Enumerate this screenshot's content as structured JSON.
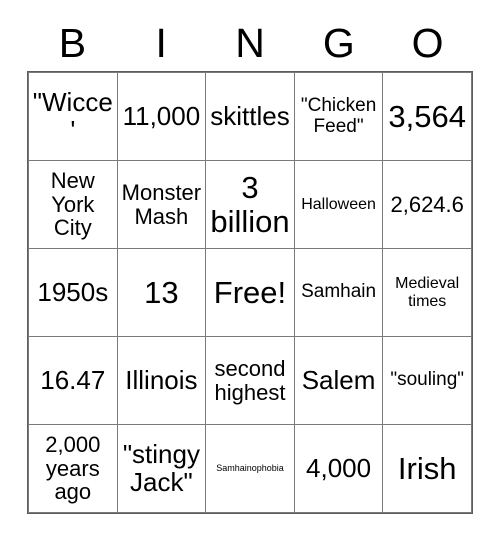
{
  "card": {
    "header": [
      "B",
      "I",
      "N",
      "G",
      "O"
    ],
    "columns": 5,
    "rows": 5,
    "free_space_label": "Free!",
    "colors": {
      "background": "#ffffff",
      "text": "#000000",
      "grid_line": "#7a7a7a",
      "outer_border": "#5d5d5d"
    },
    "cells": [
      [
        {
          "text": "\"Wicce'",
          "size": "fs-lg"
        },
        {
          "text": "11,000",
          "size": "fs-lg"
        },
        {
          "text": "skittles",
          "size": "fs-lg"
        },
        {
          "text": "\"Chicken Feed\"",
          "size": "fs-sm"
        },
        {
          "text": "3,564",
          "size": "fs-xl"
        }
      ],
      [
        {
          "text": "New York City",
          "size": "fs-md"
        },
        {
          "text": "Monster Mash",
          "size": "fs-md"
        },
        {
          "text": "3 billion",
          "size": "fs-xl"
        },
        {
          "text": "Halloween",
          "size": "fs-xs"
        },
        {
          "text": "2,624.6",
          "size": "fs-md"
        }
      ],
      [
        {
          "text": "1950s",
          "size": "fs-lg"
        },
        {
          "text": "13",
          "size": "fs-xl"
        },
        {
          "text": "Free!",
          "size": "fs-xl"
        },
        {
          "text": "Samhain",
          "size": "fs-sm"
        },
        {
          "text": "Medieval times",
          "size": "fs-xs"
        }
      ],
      [
        {
          "text": "16.47",
          "size": "fs-lg"
        },
        {
          "text": "Illinois",
          "size": "fs-lg"
        },
        {
          "text": "second highest",
          "size": "fs-md"
        },
        {
          "text": "Salem",
          "size": "fs-lg"
        },
        {
          "text": "\"souling\"",
          "size": "fs-sm"
        }
      ],
      [
        {
          "text": "2,000 years ago",
          "size": "fs-md"
        },
        {
          "text": "\"stingy Jack\"",
          "size": "fs-lg"
        },
        {
          "text": "Samhainophobia",
          "size": "fs-tiny"
        },
        {
          "text": "4,000",
          "size": "fs-lg"
        },
        {
          "text": "Irish",
          "size": "fs-xl"
        }
      ]
    ]
  }
}
